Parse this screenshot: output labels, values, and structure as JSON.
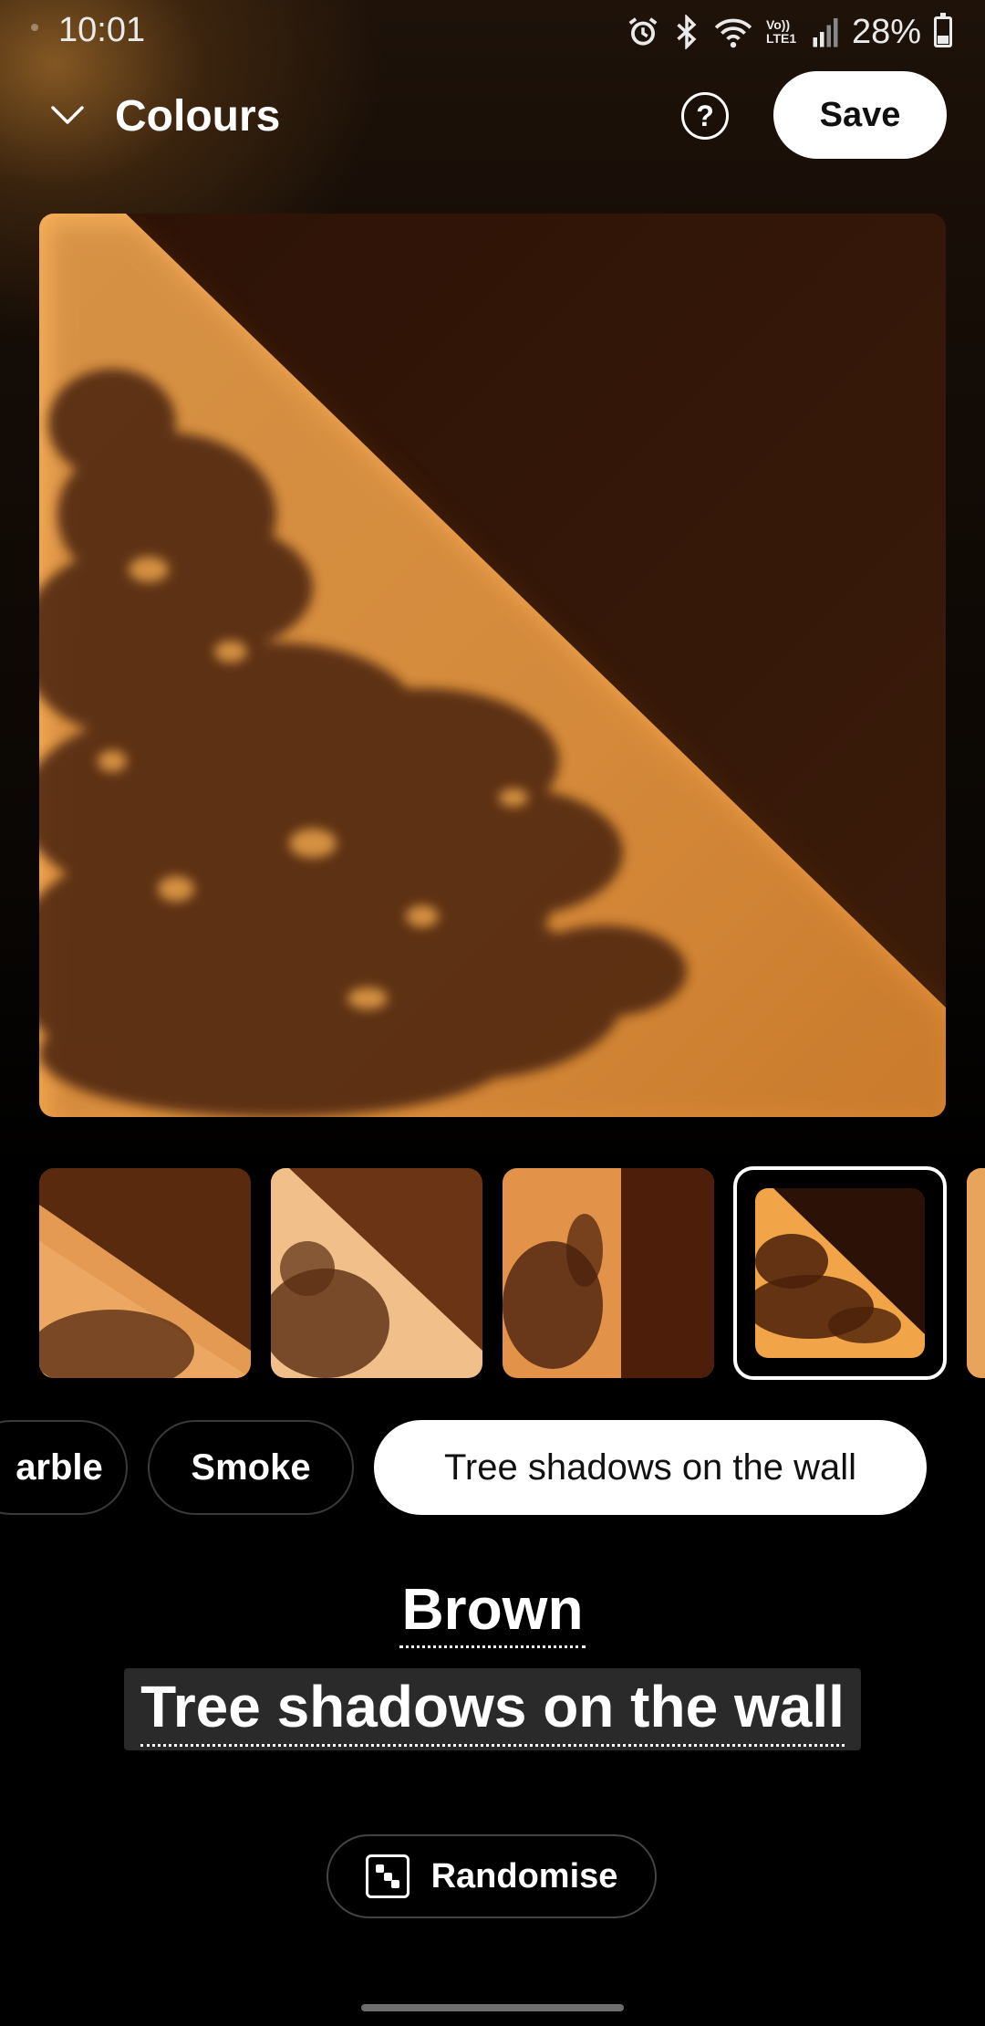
{
  "status_bar": {
    "time": "10:01",
    "network_label": "Vo)) LTE1",
    "battery_percent": "28%"
  },
  "header": {
    "title": "Colours",
    "help_label": "?",
    "save_label": "Save"
  },
  "preview": {
    "image": "tree-shadows-on-wall-preview"
  },
  "thumbnails": [
    {
      "image": "soft-light-shadow",
      "selected": false
    },
    {
      "image": "diagonal-wall-light",
      "selected": false
    },
    {
      "image": "vertical-tree-shadow",
      "selected": false
    },
    {
      "image": "tree-shadows-on-wall",
      "selected": true
    }
  ],
  "chips": [
    {
      "label": "arble",
      "active": false
    },
    {
      "label": "Smoke",
      "active": false
    },
    {
      "label": "Tree shadows on the wall",
      "active": true
    }
  ],
  "selection": {
    "color_name": "Brown",
    "style_name": "Tree shadows on the wall"
  },
  "randomise": {
    "label": "Randomise"
  },
  "colors": {
    "accent_warm": "#F5A646",
    "dark_brown": "#2E1607",
    "background": "#000000"
  }
}
